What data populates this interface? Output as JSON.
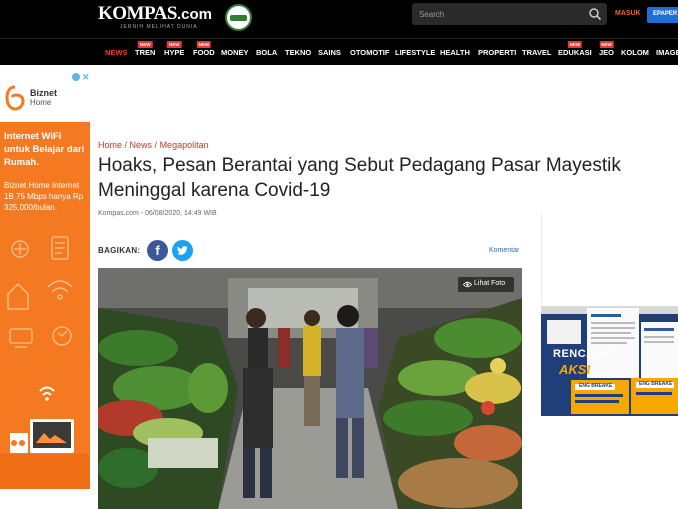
{
  "header": {
    "logo_text": "KOMPAS",
    "logo_domain": ".com",
    "tagline": "JERNIH MELIHAT DUNIA",
    "search_placeholder": "Search",
    "login_label": "MASUK",
    "epaper_label": "EPAPER"
  },
  "nav": {
    "items": [
      {
        "label": "NEWS",
        "active": true,
        "new": false
      },
      {
        "label": "TREN",
        "active": false,
        "new": true
      },
      {
        "label": "HYPE",
        "active": false,
        "new": true
      },
      {
        "label": "FOOD",
        "active": false,
        "new": true
      },
      {
        "label": "MONEY",
        "active": false,
        "new": false
      },
      {
        "label": "BOLA",
        "active": false,
        "new": false
      },
      {
        "label": "TEKNO",
        "active": false,
        "new": false
      },
      {
        "label": "SAINS",
        "active": false,
        "new": false
      },
      {
        "label": "OTOMOTIF",
        "active": false,
        "new": false
      },
      {
        "label": "LIFESTYLE",
        "active": false,
        "new": false
      },
      {
        "label": "HEALTH",
        "active": false,
        "new": false
      },
      {
        "label": "PROPERTI",
        "active": false,
        "new": false
      },
      {
        "label": "TRAVEL",
        "active": false,
        "new": false
      },
      {
        "label": "EDUKASI",
        "active": false,
        "new": true
      },
      {
        "label": "JEO",
        "active": false,
        "new": true
      },
      {
        "label": "KOLOM",
        "active": false,
        "new": false
      },
      {
        "label": "IMAGE",
        "active": false,
        "new": false
      }
    ],
    "new_tag": "NEW"
  },
  "ad_left": {
    "brand": "Biznet",
    "brand_sub": "Home",
    "headline": "Internet WiFi untuk Belajar dari Rumah.",
    "body": "Biznet Home Internet 1B 75 Mbps hanya Rp 325,000/bulan."
  },
  "article": {
    "breadcrumb": [
      "Home",
      "News",
      "Megapolitan"
    ],
    "breadcrumb_sep": " / ",
    "title": "Hoaks, Pesan Berantai yang Sebut Pedagang Pasar Mayestik Meninggal karena Covid-19",
    "meta": "Kompas.com - 06/08/2020, 14:49 WIB",
    "share_label": "BAGIKAN:",
    "comment_label": "Komentar",
    "view_photo_label": "Lihat Foto"
  },
  "ad_right": {
    "line1": "RENCANA",
    "line2": "AKSI",
    "tag1": "ENG BREAKE",
    "tag2": "ENG BREAKE"
  },
  "colors": {
    "accent_red": "#f03d2e",
    "breadcrumb": "#c0392b",
    "facebook": "#3b5998",
    "twitter": "#1da1f2",
    "ad_orange": "#f47920",
    "epaper_blue": "#1d6fd6"
  }
}
